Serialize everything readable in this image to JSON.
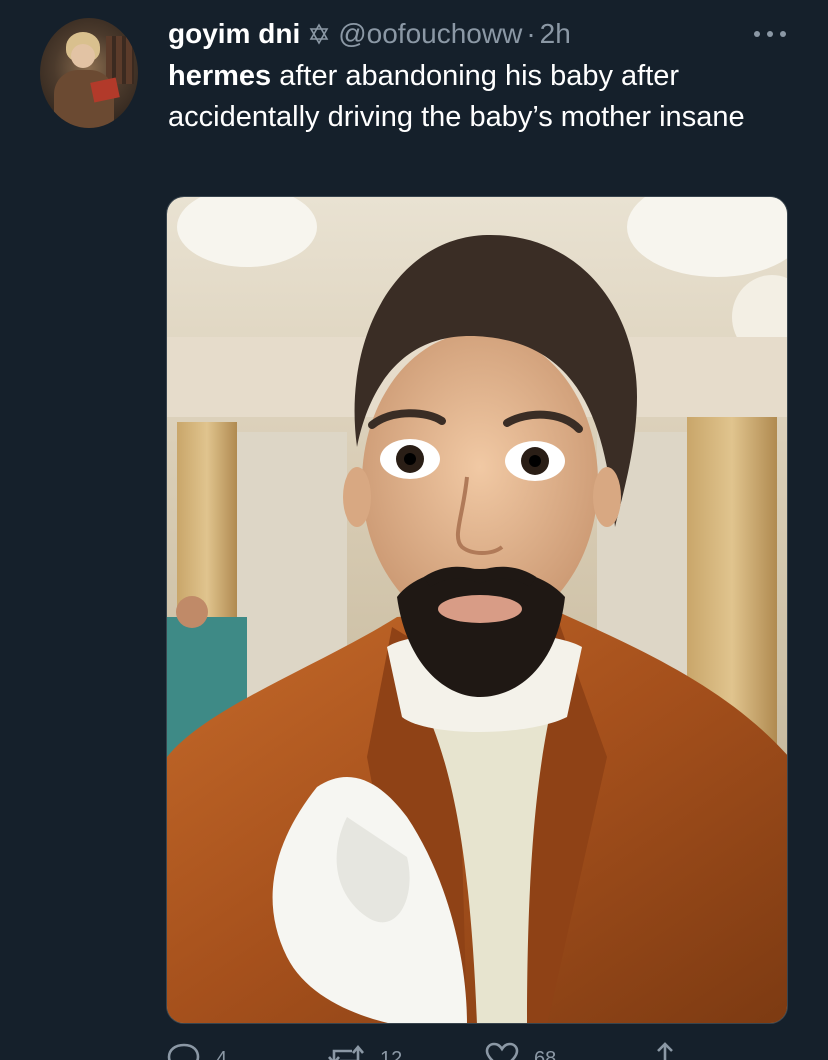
{
  "tweet": {
    "display_name": "goyim dni",
    "handle": "@oofouchoww",
    "separator": "·",
    "time": "2h",
    "text_bold": "hermes",
    "text_rest": " after abandoning his baby after accidentally driving the baby’s mother insane",
    "media_alt": "photo"
  },
  "actions": {
    "reply_count": "4",
    "retweet_count": "12",
    "like_count": "68"
  },
  "icons": {
    "star": "star-of-david-icon",
    "more": "more-options-icon",
    "reply": "reply-icon",
    "retweet": "retweet-icon",
    "like": "heart-icon",
    "share": "share-icon"
  },
  "colors": {
    "background": "#15202b",
    "text": "#ffffff",
    "muted": "#8b98a5",
    "border": "#38444d"
  }
}
